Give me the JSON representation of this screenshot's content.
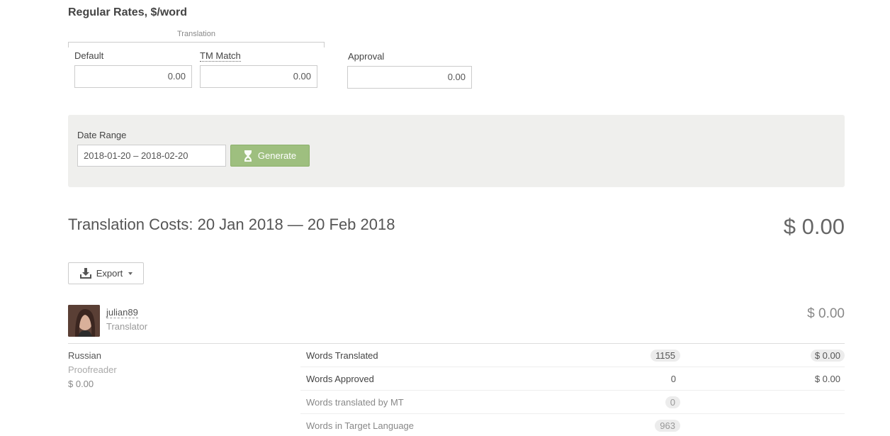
{
  "rates": {
    "title": "Regular Rates, $/word",
    "translation_group": "Translation",
    "default_label": "Default",
    "default_value": "0.00",
    "tm_match_label": "TM Match",
    "tm_match_value": "0.00",
    "approval_label": "Approval",
    "approval_value": "0.00"
  },
  "date_range": {
    "label": "Date Range",
    "value": "2018-01-20 – 2018-02-20",
    "generate_label": "Generate"
  },
  "costs": {
    "title": "Translation Costs: 20 Jan 2018 — 20 Feb 2018",
    "total": "$ 0.00",
    "export_label": "Export"
  },
  "user": {
    "name": "julian89",
    "role": "Translator",
    "total": "$ 0.00",
    "language": "Russian",
    "language_role": "Proofreader",
    "language_cost": "$ 0.00",
    "stats": [
      {
        "label": "Words Translated",
        "count": "1155",
        "cost": "$ 0.00"
      },
      {
        "label": "Words Approved",
        "count": "0",
        "cost": "$ 0.00"
      },
      {
        "label": "Words translated by MT",
        "count": "0",
        "cost": ""
      },
      {
        "label": "Words in Target Language",
        "count": "963",
        "cost": ""
      }
    ]
  },
  "colors": {
    "generate_button": "#9ebf7f",
    "panel_background": "#efefed"
  },
  "icons": {
    "generate": "hourglass-icon",
    "export": "download-tray-icon",
    "export_menu": "caret-down-icon"
  }
}
